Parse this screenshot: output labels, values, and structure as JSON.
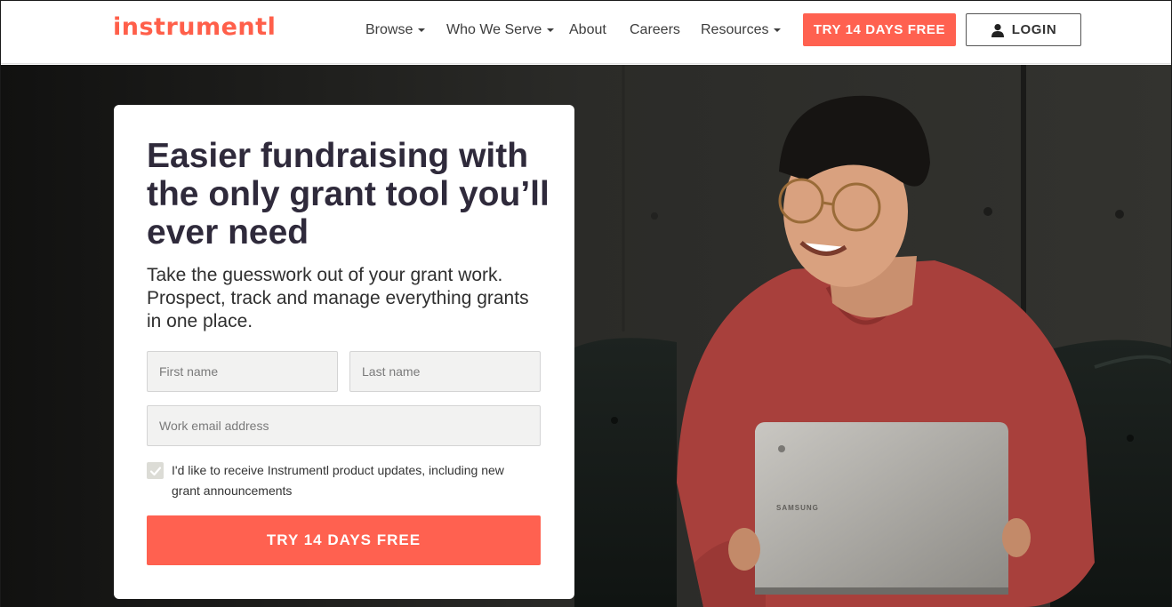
{
  "header": {
    "logo": "instrumentl",
    "nav": [
      {
        "label": "Browse",
        "dropdown": true
      },
      {
        "label": "Who We Serve",
        "dropdown": true
      },
      {
        "label": "About",
        "dropdown": false
      },
      {
        "label": "Careers",
        "dropdown": false
      },
      {
        "label": "Resources",
        "dropdown": true
      }
    ],
    "try_label": "TRY 14 DAYS FREE",
    "login_label": "LOGIN"
  },
  "hero": {
    "headline": "Easier fundraising with the only grant tool you’ll ever need",
    "subhead": "Take the guesswork out of your grant work. Prospect, track and manage everything grants in one place.",
    "form": {
      "first_name_placeholder": "First name",
      "last_name_placeholder": "Last name",
      "email_placeholder": "Work email address",
      "consent_text": "I'd like to receive Instrumentl product updates, including new grant announcements",
      "consent_checked": true,
      "submit_label": "TRY 14 DAYS FREE"
    },
    "laptop_brand": "SAMSUNG"
  },
  "colors": {
    "brand": "#ff6150",
    "headline": "#2f2a3b",
    "sweater": "#a8403c"
  },
  "icons": {
    "login": "user-icon",
    "checkbox": "checkmark-icon"
  }
}
